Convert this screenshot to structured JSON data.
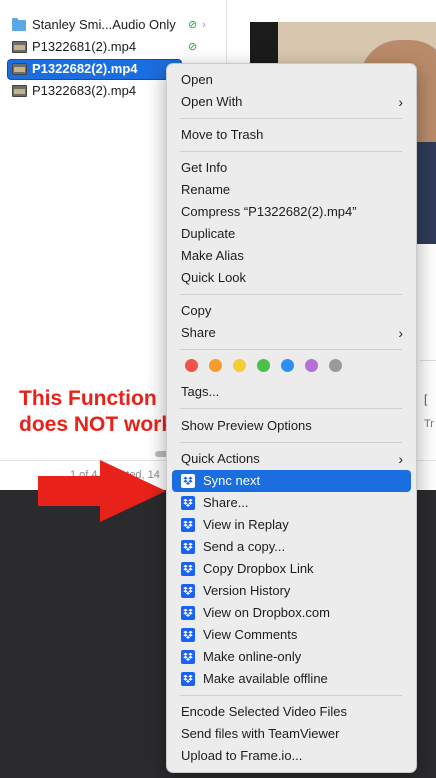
{
  "files": [
    {
      "name": "Stanley Smi...Audio Only",
      "icon": "folder-icon",
      "synced": true,
      "has_children": true
    },
    {
      "name": "P1322681(2).mp4",
      "icon": "video-file-icon",
      "synced": true
    },
    {
      "name": "P1322682(2).mp4",
      "icon": "video-file-icon",
      "selected": true
    },
    {
      "name": "P1322683(2).mp4",
      "icon": "video-file-icon"
    }
  ],
  "status_bar": {
    "text": "1 of 4 selected, 14"
  },
  "side_panel": {
    "text1": "[",
    "text2": "Tr"
  },
  "annotation": {
    "text": "This Function does NOT work",
    "color": "#e8221a"
  },
  "menu": {
    "open": "Open",
    "open_with": "Open With",
    "move_to_trash": "Move to Trash",
    "get_info": "Get Info",
    "rename": "Rename",
    "compress": "Compress “P1322682(2).mp4”",
    "duplicate": "Duplicate",
    "make_alias": "Make Alias",
    "quick_look": "Quick Look",
    "copy": "Copy",
    "share": "Share",
    "tag_colors": [
      "#f2524a",
      "#f79c2f",
      "#f6cb33",
      "#4ac04e",
      "#2f8ff3",
      "#b66fd3",
      "#9a9a9a"
    ],
    "tags": "Tags...",
    "show_preview_options": "Show Preview Options",
    "quick_actions": "Quick Actions",
    "dropbox_items": [
      "Sync next",
      "Share...",
      "View in Replay",
      "Send a copy...",
      "Copy Dropbox Link",
      "Version History",
      "View on Dropbox.com",
      "View Comments",
      "Make online-only",
      "Make available offline"
    ],
    "encode": "Encode Selected Video Files",
    "teamviewer": "Send files with TeamViewer",
    "frameio": "Upload to Frame.io..."
  },
  "colors": {
    "highlight": "#1b6ee0",
    "dropbox": "#1a62f5",
    "annotation": "#e8221a"
  }
}
